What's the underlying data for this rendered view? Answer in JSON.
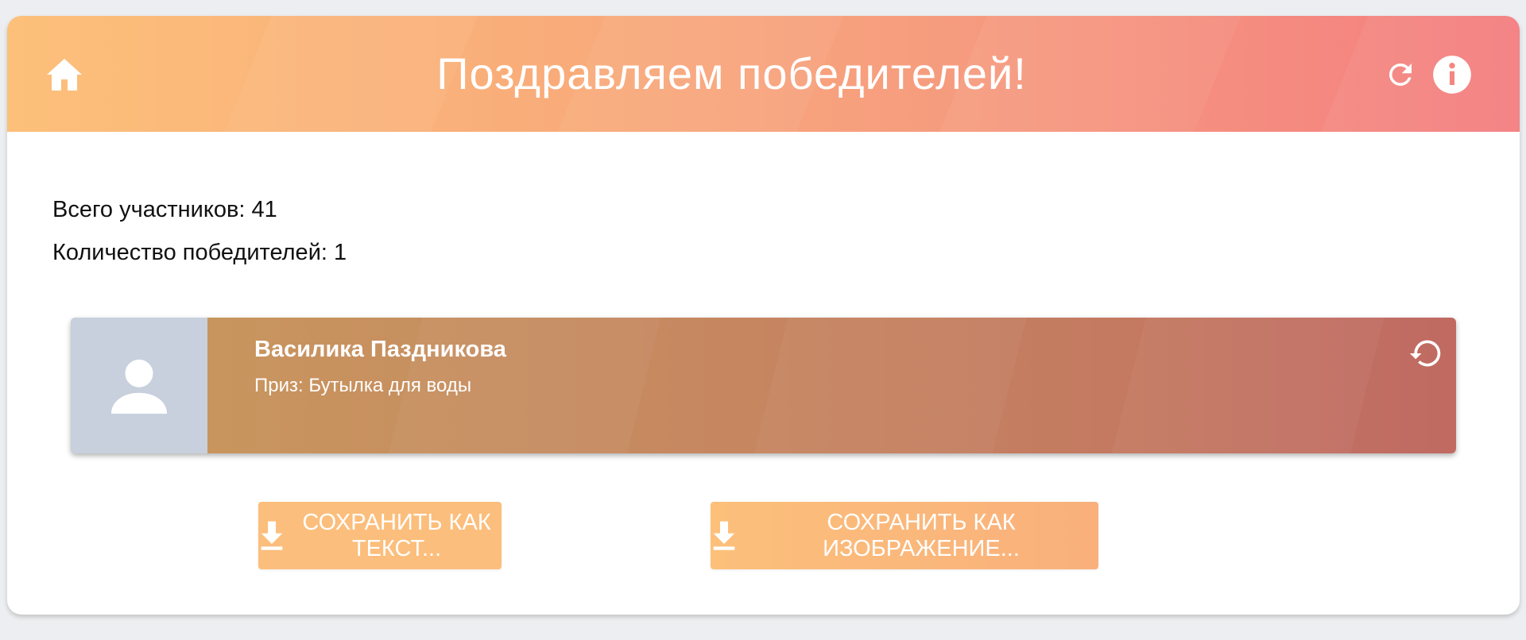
{
  "header": {
    "title": "Поздравляем победителей!",
    "icons": {
      "home": "home-icon",
      "refresh": "refresh-icon",
      "info": "info-icon"
    },
    "gradient": [
      "#fcc07a",
      "#f47e80"
    ]
  },
  "stats": {
    "total_participants": "Всего участников: 41",
    "winners_count": "Количество победителей: 1"
  },
  "winners": [
    {
      "name": "Василика Паздникова",
      "prize": "Приз: Бутылка для воды",
      "avatar_icon": "user-placeholder-icon",
      "reroll_icon": "reroll-icon"
    }
  ],
  "actions": {
    "save_text_label": "СОХРАНИТЬ КАК ТЕКСТ...",
    "save_image_label": "СОХРАНИТЬ КАК ИЗОБРАЖЕНИЕ...",
    "download_icon": "download-icon",
    "button_color": "#fcbe7c"
  }
}
